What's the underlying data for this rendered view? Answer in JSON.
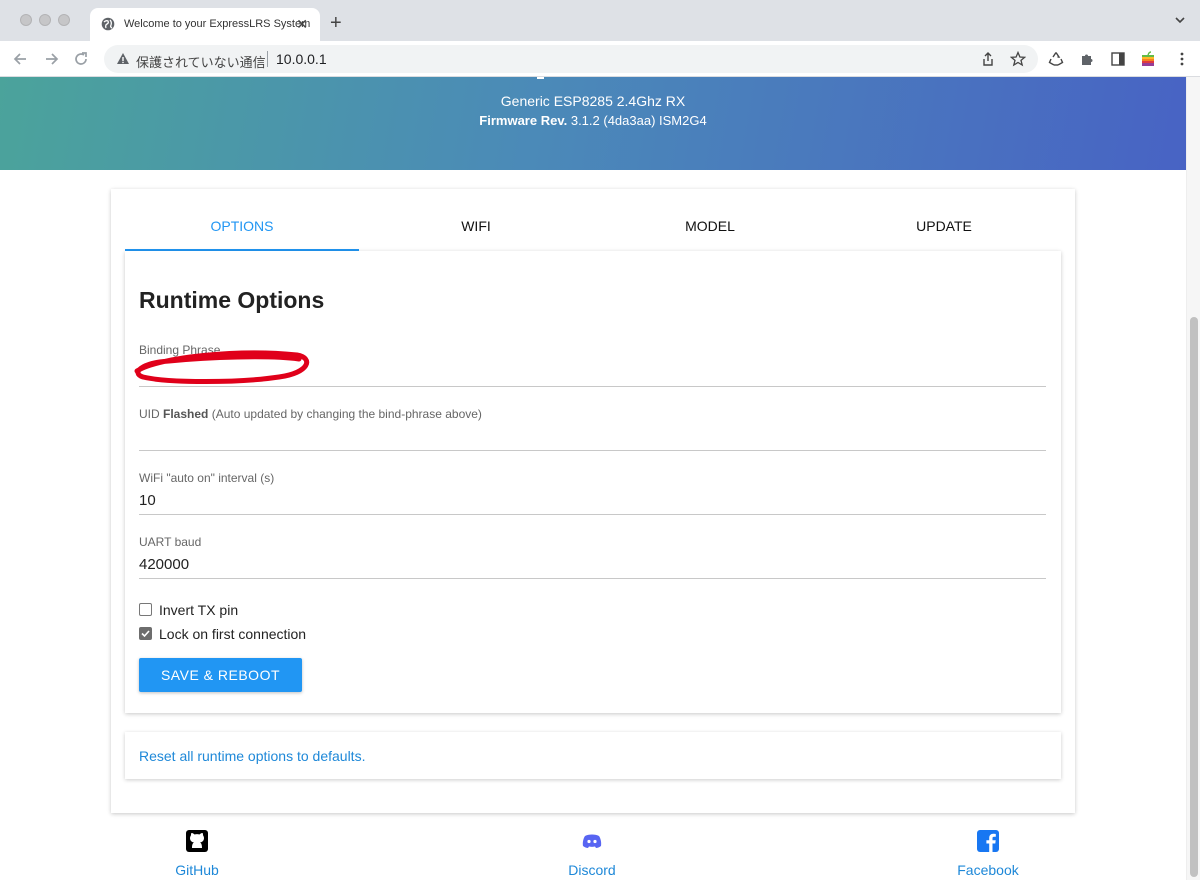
{
  "browser": {
    "tab_title": "Welcome to your ExpressLRS System",
    "tab_close": "✕",
    "new_tab": "+",
    "security_label": "保護されていない通信",
    "url": "10.0.0.1"
  },
  "header": {
    "device": "Generic ESP8285 2.4Ghz RX",
    "firmware_label": "Firmware Rev.",
    "firmware_value": "3.1.2 (4da3aa) ISM2G4"
  },
  "tabs": [
    {
      "label": "OPTIONS",
      "active": true
    },
    {
      "label": "WIFI",
      "active": false
    },
    {
      "label": "MODEL",
      "active": false
    },
    {
      "label": "UPDATE",
      "active": false
    }
  ],
  "runtime": {
    "title": "Runtime Options",
    "binding_phrase": {
      "label": "Binding Phrase",
      "value": ""
    },
    "uid": {
      "label_prefix": "UID",
      "label_bold": "Flashed",
      "label_suffix": "(Auto updated by changing the bind-phrase above)",
      "value": ""
    },
    "wifi_interval": {
      "label": "WiFi \"auto on\" interval (s)",
      "value": "10"
    },
    "uart_baud": {
      "label": "UART baud",
      "value": "420000"
    },
    "invert_tx": {
      "label": "Invert TX pin",
      "checked": false
    },
    "lock_first": {
      "label": "Lock on first connection",
      "checked": true
    },
    "save_label": "SAVE & REBOOT",
    "reset_link": "Reset all runtime options to defaults."
  },
  "footer": {
    "github": "GitHub",
    "discord": "Discord",
    "facebook": "Facebook"
  },
  "colors": {
    "accent": "#2196f3",
    "link": "#1e88d8",
    "redaction_scribble": "#e0001a"
  }
}
